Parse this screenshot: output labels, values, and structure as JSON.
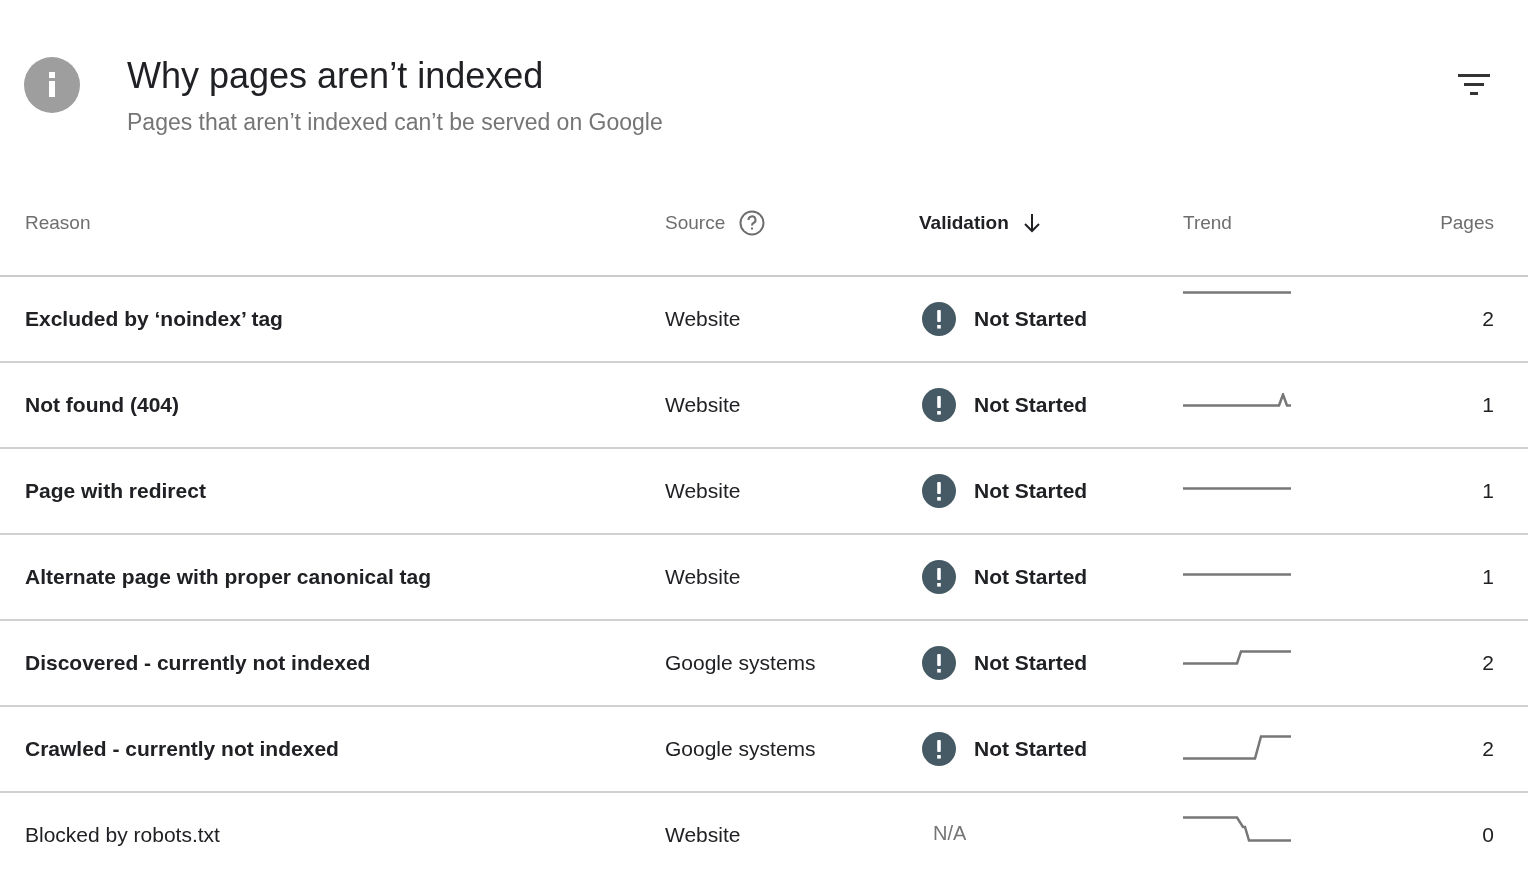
{
  "header": {
    "title": "Why pages aren’t indexed",
    "subtitle": "Pages that aren’t indexed can’t be served on Google"
  },
  "table": {
    "columns": [
      {
        "label": "Reason",
        "kind": "text",
        "sorted": false,
        "help": false
      },
      {
        "label": "Source",
        "kind": "text",
        "sorted": false,
        "help": true
      },
      {
        "label": "Validation",
        "kind": "text",
        "sorted": true,
        "help": false
      },
      {
        "label": "Trend",
        "kind": "text",
        "sorted": false,
        "help": false
      },
      {
        "label": "Pages",
        "kind": "number",
        "sorted": false,
        "help": false
      }
    ],
    "rows": [
      {
        "reason": "Excluded by ‘noindex’ tag",
        "bold": true,
        "source": "Website",
        "validation": {
          "kind": "not_started",
          "label": "Not Started"
        },
        "trend": {
          "kind": "flat_high"
        },
        "pages": "2"
      },
      {
        "reason": "Not found (404)",
        "bold": true,
        "source": "Website",
        "validation": {
          "kind": "not_started",
          "label": "Not Started"
        },
        "trend": {
          "kind": "spike"
        },
        "pages": "1"
      },
      {
        "reason": "Page with redirect",
        "bold": true,
        "source": "Website",
        "validation": {
          "kind": "not_started",
          "label": "Not Started"
        },
        "trend": {
          "kind": "flat"
        },
        "pages": "1"
      },
      {
        "reason": "Alternate page with proper canonical tag",
        "bold": true,
        "source": "Website",
        "validation": {
          "kind": "not_started",
          "label": "Not Started"
        },
        "trend": {
          "kind": "flat"
        },
        "pages": "1"
      },
      {
        "reason": "Discovered - currently not indexed",
        "bold": true,
        "source": "Google systems",
        "validation": {
          "kind": "not_started",
          "label": "Not Started"
        },
        "trend": {
          "kind": "rise_mid"
        },
        "pages": "2"
      },
      {
        "reason": "Crawled - currently not indexed",
        "bold": true,
        "source": "Google systems",
        "validation": {
          "kind": "not_started",
          "label": "Not Started"
        },
        "trend": {
          "kind": "rise_late"
        },
        "pages": "2"
      },
      {
        "reason": "Blocked by robots.txt",
        "bold": false,
        "source": "Website",
        "validation": {
          "kind": "none",
          "label": "N/A"
        },
        "trend": {
          "kind": "drop"
        },
        "pages": "0"
      }
    ]
  }
}
